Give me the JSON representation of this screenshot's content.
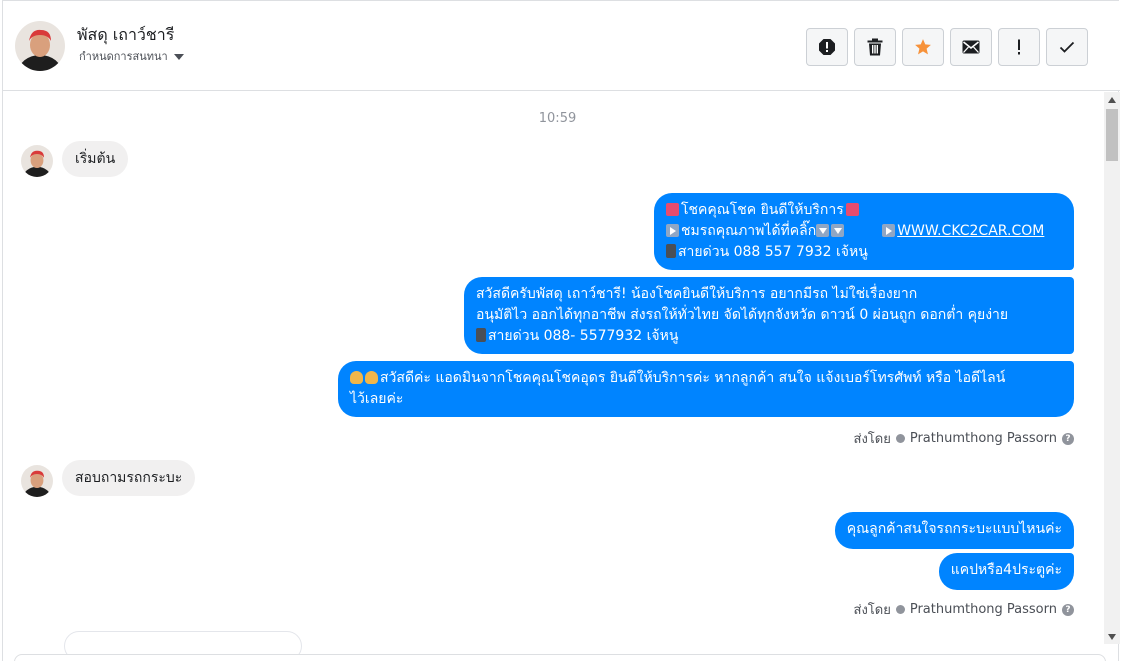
{
  "contact": {
    "name": "พัสดุ เถาว์ชารี",
    "subtitle": "กำหนดการสนทนา"
  },
  "toolbar": {
    "buttons": [
      "spam-icon",
      "trash-icon",
      "star-icon",
      "envelope-icon",
      "exclamation-icon",
      "check-icon"
    ],
    "star_color": "#f7923a"
  },
  "conversation": {
    "timestamp": "10:59",
    "messages": [
      {
        "dir": "in",
        "text": "เริ่มต้น"
      },
      {
        "dir": "out",
        "lines": [
          "โชคคุณโชค ยินดีให้บริการ",
          "ชมรถคุณภาพได้ที่คลิ๊ก",
          "WWW.CKC2CAR.COM",
          "สายด่วน 088 557 7932 เจ้หนู"
        ]
      },
      {
        "dir": "out",
        "lines": [
          "สวัสดีครับพัสดุ เถาว์ชารี! น้องโชคยินดีให้บริการ อยากมีรถ ไม่ใช่เรื่องยาก",
          "อนุมัติไว ออกได้ทุกอาชีพ ส่งรถให้ทั่วไทย จัดได้ทุกจังหวัด ดาวน์ 0  ผ่อนถูก ดอกต่ำ คุยง่าย",
          "สายด่วน 088- 5577932 เจ้หนู"
        ]
      },
      {
        "dir": "out",
        "lines": [
          "สวัสดีค่ะ แอดมินจากโชคคุณโชคอุดร ยินดีให้บริการค่ะ หากลูกค้า สนใจ แจ้งเบอร์โทรศัพท์ หรือ ไอดีไลน์",
          "ไว้เลยค่ะ"
        ]
      },
      {
        "dir": "in",
        "text": "สอบถามรถกระบะ"
      },
      {
        "dir": "out",
        "text": "คุณลูกค้าสนใจรถกระบะแบบไหนค่ะ"
      },
      {
        "dir": "out",
        "text": "แคปหรือ4ประตูค่ะ"
      }
    ],
    "sent_by_label": "ส่งโดย",
    "sent_by_name": "Prathumthong Passorn"
  },
  "colors": {
    "outgoing_bubble": "#0084ff",
    "incoming_bubble": "#f1f0f0"
  }
}
